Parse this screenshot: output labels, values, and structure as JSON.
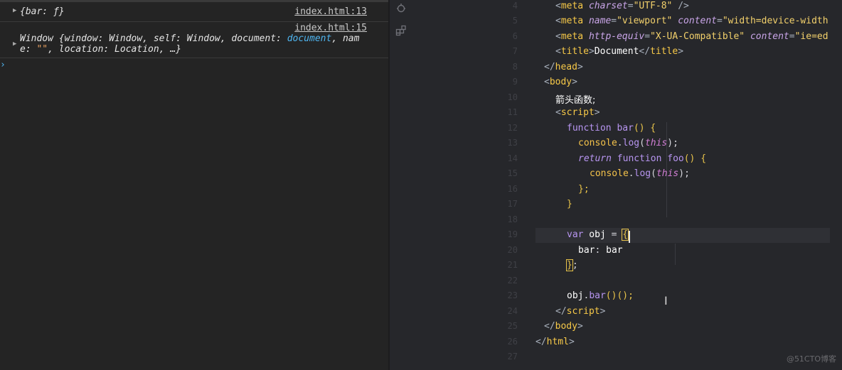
{
  "console": {
    "logs": [
      {
        "source": "index.html:13",
        "parts": [
          "{bar: ƒ}"
        ]
      },
      {
        "source": "index.html:15",
        "line1_a": "Window {window: Window, self: Window, document: ",
        "line1_b": "document",
        "line1_c": ", nam",
        "line2_a": "e: ",
        "line2_b": "\"\"",
        "line2_c": ", location: Location, …}"
      }
    ],
    "prompt_symbol": "›"
  },
  "editor": {
    "line_numbers": [
      "4",
      "5",
      "6",
      "7",
      "8",
      "9",
      "10",
      "11",
      "12",
      "13",
      "14",
      "15",
      "16",
      "17",
      "18",
      "19",
      "20",
      "21",
      "22",
      "23",
      "24",
      "25",
      "26",
      "27"
    ],
    "line4": {
      "open": "<",
      "tag": "meta",
      "attr": "charset",
      "eq": "=",
      "val": "\"UTF-8\"",
      "close": " />"
    },
    "line5": {
      "open": "<",
      "tag": "meta",
      "attr1": "name",
      "val1": "\"viewport\"",
      "attr2": "content",
      "val2": "\"width=device-width"
    },
    "line6": {
      "open": "<",
      "tag": "meta",
      "attr1": "http-equiv",
      "val1": "\"X-UA-Compatible\"",
      "attr2": "content",
      "val2": "\"ie=ed"
    },
    "line7": {
      "open": "<",
      "tag": "title",
      "close": ">",
      "text": "Document",
      "endopen": "</",
      "endtag": "title",
      "endclose": ">"
    },
    "line8": {
      "open": "</",
      "tag": "head",
      "close": ">"
    },
    "line9": {
      "open": "<",
      "tag": "body",
      "close": ">"
    },
    "line10": {
      "text": "箭头函数;"
    },
    "line11": {
      "open": "<",
      "tag": "script",
      "close": ">"
    },
    "line12": {
      "kw": "function",
      "name": " bar",
      "rest": "() {"
    },
    "line13": {
      "obj": "console",
      "dot": ".",
      "fn": "log",
      "p1": "(",
      "this": "this",
      "p2": ");"
    },
    "line14": {
      "ret": "return",
      "kw": " function",
      "name": " foo",
      "rest": "() {"
    },
    "line15": {
      "obj": "console",
      "dot": ".",
      "fn": "log",
      "p1": "(",
      "this": "this",
      "p2": ");"
    },
    "line16": {
      "text": "};"
    },
    "line17": {
      "text": "}"
    },
    "line19": {
      "kw": "var",
      "name": " obj",
      "eq": " = ",
      "brace": "{"
    },
    "line20": {
      "key": "bar",
      "colon": ": ",
      "val": "bar"
    },
    "line21": {
      "brace": "}",
      "semi": ";"
    },
    "line23": {
      "obj": "obj",
      "dot": ".",
      "fn": "bar",
      "rest": "()();"
    },
    "line24": {
      "open": "</",
      "tag": "script",
      "close": ">"
    },
    "line25": {
      "open": "</",
      "tag": "body",
      "close": ">"
    },
    "line26": {
      "open": "</",
      "tag": "html",
      "close": ">"
    }
  },
  "watermark": "@51CTO博客",
  "colors": {
    "accent_blue": "#4fb5f0",
    "tag_yellow": "#f7c948",
    "keyword_purple": "#b795f0"
  }
}
